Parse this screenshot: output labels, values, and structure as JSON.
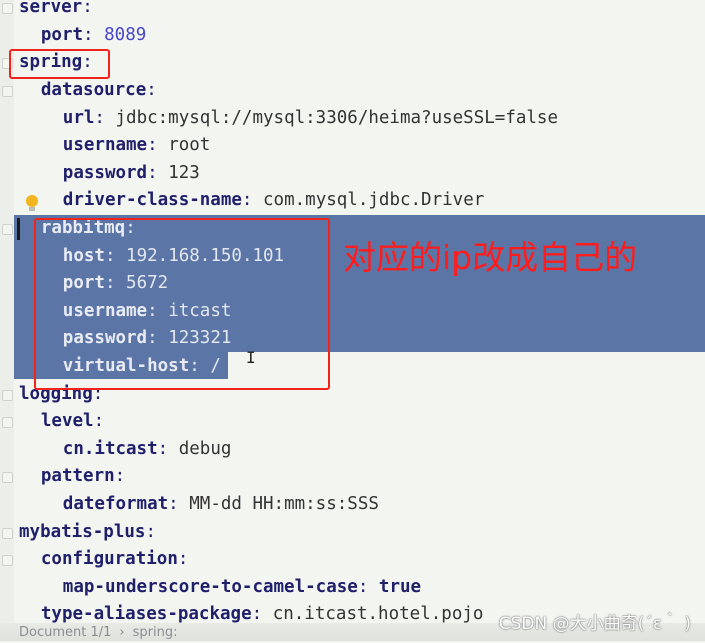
{
  "editor": {
    "lines": [
      {
        "indent": 0,
        "key": "server",
        "value": "",
        "type": ""
      },
      {
        "indent": 1,
        "key": "port",
        "value": "8089",
        "type": "num"
      },
      {
        "indent": 0,
        "key": "spring",
        "value": "",
        "type": ""
      },
      {
        "indent": 1,
        "key": "datasource",
        "value": "",
        "type": ""
      },
      {
        "indent": 2,
        "key": "url",
        "value": "jdbc:mysql://mysql:3306/heima?useSSL=false",
        "type": "val"
      },
      {
        "indent": 2,
        "key": "username",
        "value": "root",
        "type": "val"
      },
      {
        "indent": 2,
        "key": "password",
        "value": "123",
        "type": "val"
      },
      {
        "indent": 2,
        "key": "driver-class-name",
        "value": "com.mysql.jdbc.Driver",
        "type": "val"
      },
      {
        "indent": 1,
        "key": "rabbitmq",
        "value": "",
        "type": "",
        "selected": true
      },
      {
        "indent": 2,
        "key": "host",
        "value": "192.168.150.101",
        "type": "val",
        "selected": true
      },
      {
        "indent": 2,
        "key": "port",
        "value": "5672",
        "type": "num",
        "selected": true
      },
      {
        "indent": 2,
        "key": "username",
        "value": "itcast",
        "type": "val",
        "selected": true
      },
      {
        "indent": 2,
        "key": "password",
        "value": "123321",
        "type": "num",
        "selected": true
      },
      {
        "indent": 2,
        "key": "virtual-host",
        "value": "/",
        "type": "val",
        "selected": true
      },
      {
        "indent": 0,
        "key": "logging",
        "value": "",
        "type": ""
      },
      {
        "indent": 1,
        "key": "level",
        "value": "",
        "type": ""
      },
      {
        "indent": 2,
        "key": "cn.itcast",
        "value": "debug",
        "type": "val"
      },
      {
        "indent": 1,
        "key": "pattern",
        "value": "",
        "type": ""
      },
      {
        "indent": 2,
        "key": "dateformat",
        "value": "MM-dd HH:mm:ss:SSS",
        "type": "val"
      },
      {
        "indent": 0,
        "key": "mybatis-plus",
        "value": "",
        "type": ""
      },
      {
        "indent": 1,
        "key": "configuration",
        "value": "",
        "type": ""
      },
      {
        "indent": 2,
        "key": "map-underscore-to-camel-case",
        "value": "true",
        "type": "bool"
      },
      {
        "indent": 1,
        "key": "type-aliases-package",
        "value": "cn.itcast.hotel.pojo",
        "type": "val"
      }
    ]
  },
  "annotation": {
    "text": "对应的ip改成自己的",
    "color": "#f0241b"
  },
  "selection_color": "#5b75a6",
  "status_bar": {
    "document": "Document 1/1",
    "breadcrumb": "spring:"
  },
  "watermark": "CSDN @大小曲奇(´ε｀ )"
}
